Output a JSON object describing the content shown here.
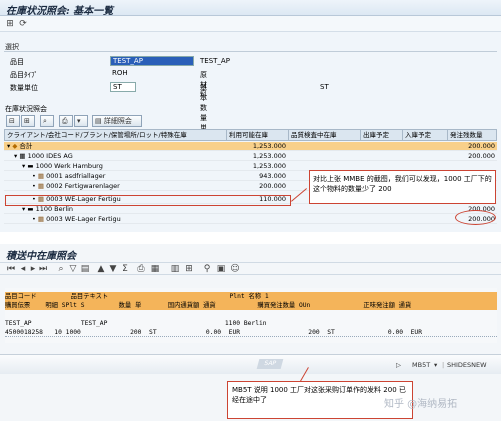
{
  "top": {
    "title": "在庫状況照会: 基本一覧",
    "selection": {
      "header": "選択",
      "fields": [
        {
          "label": "品目",
          "value": "TEST_AP",
          "desc": "TEST_AP"
        },
        {
          "label": "品目ﾀｲﾌﾟ",
          "value": "ROH",
          "desc": "原材料"
        },
        {
          "label": "数量単位",
          "value": "ST",
          "desc": "基本数量単位",
          "desc_value": "ST"
        }
      ]
    },
    "stock": {
      "header": "在庫状況照会",
      "detail_button": "詳細照会",
      "columns": [
        "クライアント/会社コード/プラント/保管場所/ロット/特殊在庫",
        "利用可能在庫",
        "品質検査中在庫",
        "出庫予定",
        "入庫予定",
        "発注残数量"
      ],
      "rows": [
        {
          "label": "合計",
          "available": "1,253.000",
          "open_po": "200.000",
          "total": true
        },
        {
          "label": "1000 IDES AG",
          "available": "1,253.000",
          "open_po": "200.000"
        },
        {
          "label": "1000 Werk Hamburg",
          "available": "1,253.000",
          "open_po": ""
        },
        {
          "label": "0001 asdfriallager",
          "available": "943.000",
          "open_po": ""
        },
        {
          "label": "0002 Fertigwarenlager",
          "available": "200.000",
          "open_po": ""
        },
        {
          "label": "0003 WE-Lager Fertigu",
          "available": "110.000",
          "open_po": ""
        },
        {
          "label": "1100 Berlin",
          "available": "",
          "open_po": "200.000"
        },
        {
          "label": "0003 WE-Lager Fertigu",
          "available": "",
          "open_po": "200.000"
        }
      ]
    },
    "callout": "对比上张 MMBE 的截图，我们可以发现，1000 工厂下的这个物料的数量少了 200"
  },
  "bottom": {
    "title": "積送中在庫照会",
    "list": {
      "header1": "品目コード         品目テキスト                                Plnt 名称 1",
      "header2": "購買伝票    明細 SPlt S         数量 単       国内通貨額 通貨           購買発注数量 OUn              正味発注額 通貨",
      "row1": "TEST_AP             TEST_AP                               1100 Berlin",
      "row2": "4500018258   10 1000             200  ST             0.00  EUR                  200  ST              0.00  EUR"
    },
    "status": {
      "mark": "SAP",
      "transaction": "MB5T",
      "server": "SHIDESNEW"
    },
    "callout": "MB5T 说明 1000 工厂对这张采购订单作的发料 200 已经在途中了",
    "watermark": "知乎 @海纳易拓"
  }
}
